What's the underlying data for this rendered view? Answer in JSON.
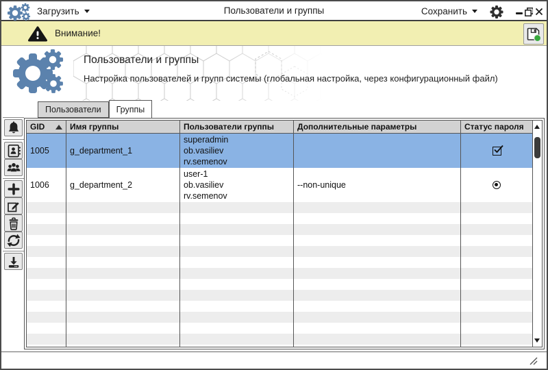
{
  "titlebar": {
    "load_label": "Загрузить",
    "title": "Пользователи и группы",
    "save_label": "Сохранить",
    "icons": [
      "app-gears-icon",
      "settings-gear-icon",
      "minimize-icon",
      "maximize-icon",
      "close-icon"
    ]
  },
  "warning_bar": {
    "label": "Внимание!",
    "icons": [
      "warning-triangle-icon",
      "save-diskette-icon-with-green-badge"
    ],
    "background_color": "#f2efb2"
  },
  "header": {
    "title": "Пользователи и группы",
    "subtitle": "Настройка пользователей и групп системы (глобальная настройка, через конфигурационный файл)",
    "logo_icon": "blue-gears-logo",
    "accent_color": "#5b82ad"
  },
  "tabs": [
    {
      "label": "Пользователи",
      "active": false
    },
    {
      "label": "Группы",
      "active": true
    }
  ],
  "toolbar": {
    "buttons": [
      {
        "icon": "bell-icon"
      },
      {
        "icon": "contact-card-icon"
      },
      {
        "icon": "users-group-icon"
      },
      {
        "icon": "add-plus-icon"
      },
      {
        "icon": "edit-pencil-icon"
      },
      {
        "icon": "trash-icon"
      },
      {
        "icon": "refresh-icon"
      },
      {
        "icon": "download-icon"
      }
    ]
  },
  "table": {
    "columns": [
      {
        "label": "GID",
        "sort": "ascending"
      },
      {
        "label": "Имя группы"
      },
      {
        "label": "Пользователи группы"
      },
      {
        "label": "Дополнительные параметры"
      },
      {
        "label": "Статус пароля"
      }
    ],
    "rows": [
      {
        "gid": "1005",
        "name": "g_department_1",
        "users": [
          "superadmin",
          "ob.vasiliev",
          "rv.semenov"
        ],
        "params": "",
        "password_status": "checkbox-checked",
        "selected": true
      },
      {
        "gid": "1006",
        "name": "g_department_2",
        "users": [
          "user-1",
          "ob.vasiliev",
          "rv.semenov"
        ],
        "params": "--non-unique",
        "password_status": "radio-selected",
        "selected": false
      }
    ],
    "selection_color": "#8ab3e4",
    "header_color": "#d2d2d2",
    "stripe_color": "#ededed"
  }
}
